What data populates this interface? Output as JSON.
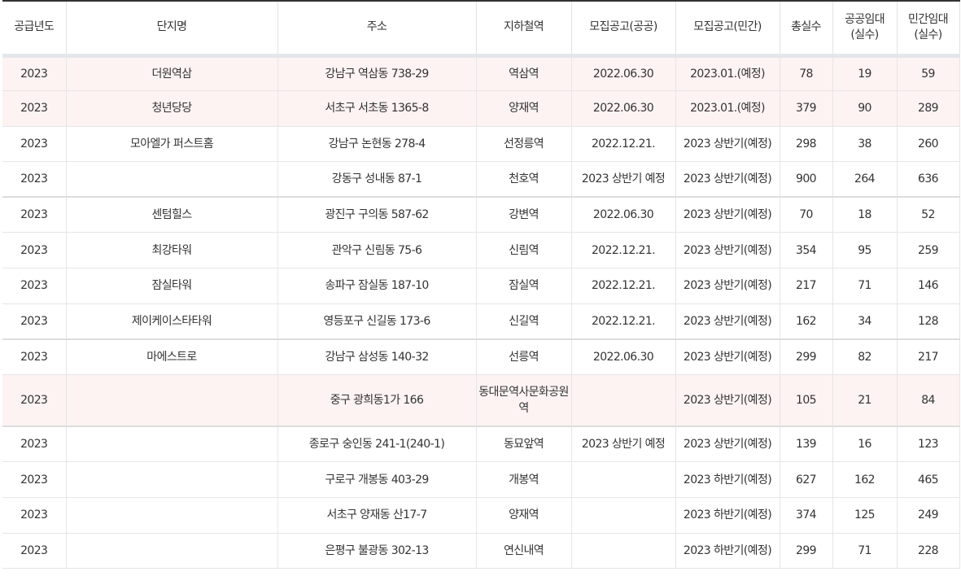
{
  "table": {
    "headers": [
      "공급년도",
      "단지명",
      "주소",
      "지하철역",
      "모집공고(공공)",
      "모집공고(민간)",
      "총실수",
      "공공임대\n(실수)",
      "민간임대\n(실수)"
    ],
    "rows": [
      [
        "2023",
        "더원역삼",
        "강남구 역삼동 738-29",
        "역삼역",
        "2022.06.30",
        "2023.01.(예정)",
        "78",
        "19",
        "59"
      ],
      [
        "2023",
        "청년당당",
        "서초구 서초동 1365-8",
        "양재역",
        "2022.06.30",
        "2023.01.(예정)",
        "379",
        "90",
        "289"
      ],
      [
        "2023",
        "모아엘가 퍼스트홈",
        "강남구 논현동 278-4",
        "선정릉역",
        "2022.12.21.",
        "2023 상반기(예정)",
        "298",
        "38",
        "260"
      ],
      [
        "2023",
        "",
        "강동구 성내동 87-1",
        "천호역",
        "2023 상반기 예정",
        "2023 상반기(예정)",
        "900",
        "264",
        "636"
      ],
      [
        "2023",
        "센텀힐스",
        "광진구 구의동 587-62",
        "강변역",
        "2022.06.30",
        "2023 상반기(예정)",
        "70",
        "18",
        "52"
      ],
      [
        "2023",
        "최강타워",
        "관악구 신림동 75-6",
        "신림역",
        "2022.12.21.",
        "2023 상반기(예정)",
        "354",
        "95",
        "259"
      ],
      [
        "2023",
        "잠실타워",
        "송파구 잠실동 187-10",
        "잠실역",
        "2022.12.21.",
        "2023 상반기(예정)",
        "217",
        "71",
        "146"
      ],
      [
        "2023",
        "제이케이스타타워",
        "영등포구 신길동 173-6",
        "신길역",
        "2022.12.21.",
        "2023 상반기(예정)",
        "162",
        "34",
        "128"
      ],
      [
        "2023",
        "마에스트로",
        "강남구 삼성동 140-32",
        "선릉역",
        "2022.06.30",
        "2023 상반기(예정)",
        "299",
        "82",
        "217"
      ],
      [
        "2023",
        "",
        "중구 광희동1가 166",
        "동대문역사문화공원역",
        "",
        "2023 상반기(예정)",
        "105",
        "21",
        "84"
      ],
      [
        "2023",
        "",
        "종로구 숭인동 241-1(240-1)",
        "동묘앞역",
        "2023 상반기 예정",
        "2023 상반기(예정)",
        "139",
        "16",
        "123"
      ],
      [
        "2023",
        "",
        "구로구 개봉동 403-29",
        "개봉역",
        "",
        "2023 하반기(예정)",
        "627",
        "162",
        "465"
      ],
      [
        "2023",
        "",
        "서초구 양재동 산17-7",
        "양재역",
        "",
        "2023 하반기(예정)",
        "374",
        "125",
        "249"
      ],
      [
        "2023",
        "",
        "은평구 불광동 302-13",
        "연신내역",
        "",
        "2023 하반기(예정)",
        "299",
        "71",
        "228"
      ]
    ]
  },
  "colors": {
    "highlight_row_bg": "#fdf3f3",
    "header_top_border": "#333333",
    "text": "#333333"
  }
}
